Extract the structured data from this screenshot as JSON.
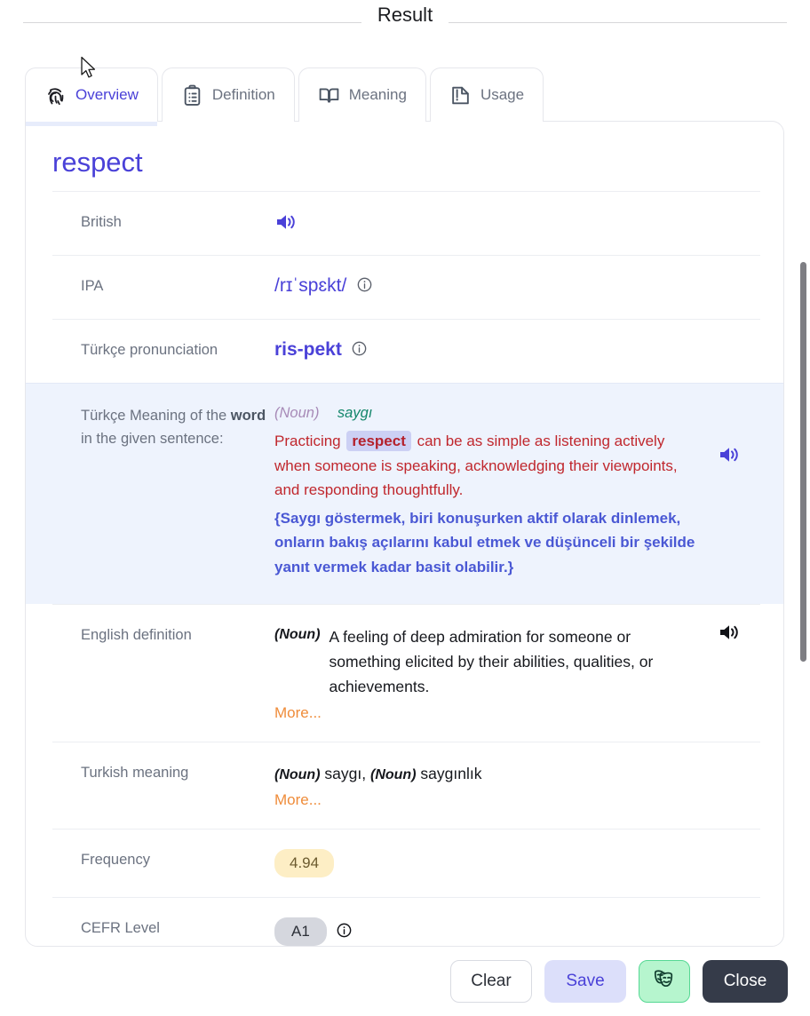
{
  "header": {
    "legend": "Result"
  },
  "tabs": [
    {
      "label": "Overview",
      "icon": "fingerprint-icon",
      "active": true
    },
    {
      "label": "Definition",
      "icon": "clipboard-list-icon",
      "active": false
    },
    {
      "label": "Meaning",
      "icon": "open-book-icon",
      "active": false
    },
    {
      "label": "Usage",
      "icon": "book-page-icon",
      "active": false
    }
  ],
  "word": {
    "title": "respect"
  },
  "rows": {
    "british": {
      "label": "British",
      "audio_icon": "speaker-icon"
    },
    "ipa": {
      "label": "IPA",
      "value": "/rɪˈspɛkt/",
      "info_icon": "info-icon"
    },
    "turkce_pronunciation": {
      "label": "Türkçe pronunciation",
      "value": "ris-pekt",
      "info_icon": "info-icon"
    },
    "turkce_meaning": {
      "label_part1": "Türkçe Meaning of the ",
      "label_bold": "word",
      "label_part2": " in the given sentence:",
      "pos": "(Noun)",
      "gloss": "saygı",
      "sentence_before": "Practicing ",
      "sentence_chip": "respect",
      "sentence_after": " can be as simple as listening actively when someone is speaking, acknowledging their viewpoints, and responding thoughtfully.",
      "sentence_tr": "{Saygı göstermek, biri konuşurken aktif olarak dinlemek, onların bakış açılarını kabul etmek ve düşünceli bir şekilde yanıt vermek kadar basit olabilir.}",
      "audio_icon": "speaker-icon"
    },
    "english_definition": {
      "label": "English definition",
      "pos": "(Noun)",
      "text": "A feeling of deep admiration for someone or something elicited by their abilities, qualities, or achievements.",
      "more": "More...",
      "audio_icon": "speaker-icon"
    },
    "turkish_meaning": {
      "label": "Turkish meaning",
      "pos1": "(Noun)",
      "value1": "saygı",
      "separator": ",",
      "pos2": "(Noun)",
      "value2": "saygınlık",
      "more": "More..."
    },
    "frequency": {
      "label": "Frequency",
      "value": "4.94"
    },
    "cefr": {
      "label": "CEFR Level",
      "value": "A1",
      "info_icon": "info-icon"
    }
  },
  "footer": {
    "clear_label": "Clear",
    "save_label": "Save",
    "theater_icon": "theater-masks-icon",
    "close_label": "Close"
  },
  "colors": {
    "accent_purple": "#4a41d8",
    "sentence_red": "#c0272d",
    "sentence_tr_blue": "#4a58d4",
    "gloss_green": "#13866b",
    "pos_lilac": "#a78ab7",
    "more_orange": "#ef8c3a",
    "highlight_bg": "#eef3fd",
    "chip_bg": "#ccd0f4",
    "freq_badge_bg": "#fdeec5",
    "cefr_badge_bg": "#d5d7de",
    "save_bg": "#dcdffa",
    "theater_bg": "#b6f5ce",
    "close_bg": "#353b49"
  }
}
